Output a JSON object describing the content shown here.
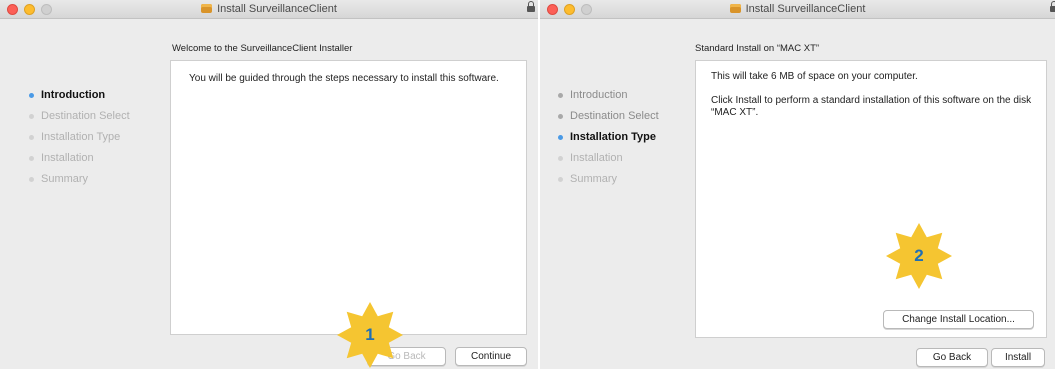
{
  "left_window": {
    "title": "Install SurveillanceClient",
    "heading": "Welcome to the SurveillanceClient Installer",
    "steps": [
      "Introduction",
      "Destination Select",
      "Installation Type",
      "Installation",
      "Summary"
    ],
    "active_step": "Introduction",
    "body_text": "You will be guided through the steps necessary to install this software.",
    "go_back_label": "Go Back",
    "continue_label": "Continue",
    "badge_number": "1"
  },
  "right_window": {
    "title": "Install SurveillanceClient",
    "heading": "Standard Install on “MAC XT”",
    "steps": [
      "Introduction",
      "Destination Select",
      "Installation Type",
      "Installation",
      "Summary"
    ],
    "active_step": "Installation Type",
    "space_text": "This will take 6 MB of space on your computer.",
    "install_text": "Click Install to perform a standard installation of this software on the disk “MAC XT”.",
    "change_location_label": "Change Install Location...",
    "go_back_label": "Go Back",
    "install_label": "Install",
    "badge_number": "2"
  },
  "colors": {
    "window_bg": "#ececec",
    "active_dot": "#4a9ae6",
    "badge_fill": "#f5c531",
    "badge_text": "#1f6fb5"
  },
  "icons": {
    "package": "package-icon",
    "lock": "lock-icon"
  }
}
